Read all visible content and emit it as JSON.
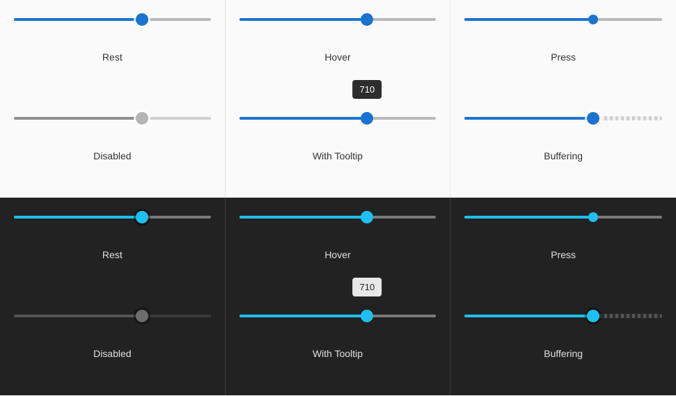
{
  "tooltip_value": "710",
  "labels": {
    "rest": "Rest",
    "hover": "Hover",
    "press": "Press",
    "disabled": "Disabled",
    "with_tooltip": "With Tooltip",
    "buffering": "Buffering"
  },
  "sliders": {
    "rest": {
      "value_percent": 65
    },
    "hover": {
      "value_percent": 65
    },
    "press": {
      "value_percent": 65
    },
    "disabled": {
      "value_percent": 65
    },
    "with_tooltip": {
      "value_percent": 65,
      "tooltip": "710"
    },
    "buffering": {
      "value_percent": 65,
      "buffer_percent": 65
    }
  },
  "colors": {
    "light_accent": "#1a73d1",
    "dark_accent": "#1dc0ee",
    "light_bg": "#fafafa",
    "dark_bg": "#222222"
  }
}
